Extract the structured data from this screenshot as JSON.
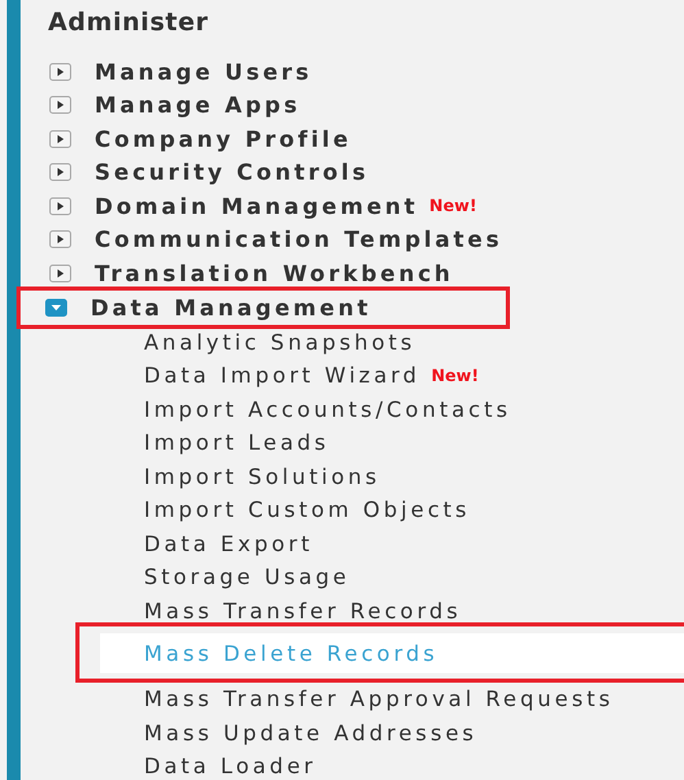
{
  "heading": "Administer",
  "categories": [
    {
      "label": "Manage Users",
      "expanded": false,
      "highlighted": false
    },
    {
      "label": "Manage Apps",
      "expanded": false,
      "highlighted": false
    },
    {
      "label": "Company Profile",
      "expanded": false,
      "highlighted": false
    },
    {
      "label": "Security Controls",
      "expanded": false,
      "highlighted": false
    },
    {
      "label": "Domain Management",
      "badge": "New!",
      "expanded": false,
      "highlighted": false
    },
    {
      "label": "Communication Templates",
      "expanded": false,
      "highlighted": false
    },
    {
      "label": "Translation Workbench",
      "expanded": false,
      "highlighted": false
    },
    {
      "label": "Data Management",
      "expanded": true,
      "highlighted": true,
      "children": [
        {
          "label": "Analytic Snapshots",
          "selected": false,
          "highlighted": false
        },
        {
          "label": "Data Import Wizard",
          "badge": "New!",
          "selected": false,
          "highlighted": false
        },
        {
          "label": "Import Accounts/Contacts",
          "selected": false,
          "highlighted": false
        },
        {
          "label": "Import Leads",
          "selected": false,
          "highlighted": false
        },
        {
          "label": "Import Solutions",
          "selected": false,
          "highlighted": false
        },
        {
          "label": "Import Custom Objects",
          "selected": false,
          "highlighted": false
        },
        {
          "label": "Data Export",
          "selected": false,
          "highlighted": false
        },
        {
          "label": "Storage Usage",
          "selected": false,
          "highlighted": false
        },
        {
          "label": "Mass Transfer Records",
          "selected": false,
          "highlighted": false
        },
        {
          "label": "Mass Delete Records",
          "selected": true,
          "highlighted": true
        },
        {
          "label": "Mass Transfer Approval Requests",
          "selected": false,
          "highlighted": false
        },
        {
          "label": "Mass Update Addresses",
          "selected": false,
          "highlighted": false
        },
        {
          "label": "Data Loader",
          "selected": false,
          "highlighted": false
        }
      ]
    }
  ]
}
